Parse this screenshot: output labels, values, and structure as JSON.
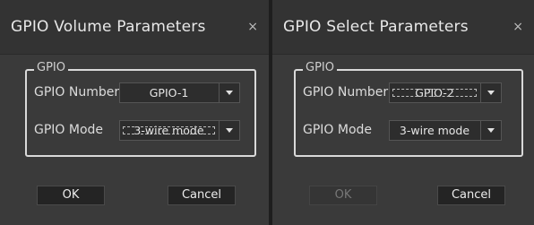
{
  "volume_dialog": {
    "title": "GPIO Volume Parameters",
    "close_glyph": "×",
    "group_label": "GPIO",
    "gpio_number_label": "GPIO Number",
    "gpio_number_value": "GPIO-1",
    "gpio_mode_label": "GPIO Mode",
    "gpio_mode_value": "3-wire mode",
    "ok_label": "OK",
    "cancel_label": "Cancel"
  },
  "select_dialog": {
    "title": "GPIO Select Parameters",
    "close_glyph": "×",
    "group_label": "GPIO",
    "gpio_number_label": "GPIO Number",
    "gpio_number_value": "GPIO-2",
    "gpio_mode_label": "GPIO Mode",
    "gpio_mode_value": "3-wire mode",
    "ok_label": "OK",
    "ok_enabled": false,
    "cancel_label": "Cancel"
  }
}
